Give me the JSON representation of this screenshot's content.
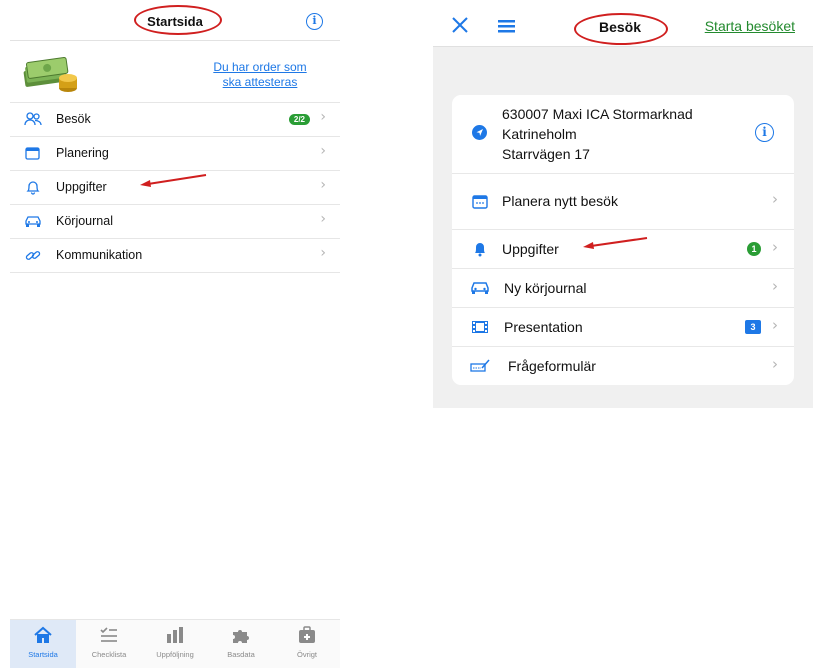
{
  "left": {
    "header": {
      "title": "Startsida",
      "info_icon": "info-circle-icon"
    },
    "order_notice": {
      "icon": "money-stack-icon",
      "line1": "Du har order som",
      "line2": "ska attesteras"
    },
    "menu": [
      {
        "label": "Besök",
        "icon": "people-icon",
        "badge": "2/2"
      },
      {
        "label": "Planering",
        "icon": "calendar-icon"
      },
      {
        "label": "Uppgifter",
        "icon": "bell-icon"
      },
      {
        "label": "Körjournal",
        "icon": "car-icon"
      },
      {
        "label": "Kommunikation",
        "icon": "link-icon"
      }
    ],
    "tabbar": [
      {
        "label": "Startsida",
        "icon": "home-icon",
        "active": true
      },
      {
        "label": "Checklista",
        "icon": "checklist-icon"
      },
      {
        "label": "Uppföljning",
        "icon": "bar-chart-icon"
      },
      {
        "label": "Basdata",
        "icon": "puzzle-icon"
      },
      {
        "label": "Övrigt",
        "icon": "medkit-icon"
      }
    ]
  },
  "right": {
    "header": {
      "title": "Besök",
      "action": "Starta besöket",
      "close_icon": "close-icon",
      "menu_icon": "hamburger-menu-icon"
    },
    "store": {
      "line1": "630007 Maxi ICA Stormarknad",
      "line2": "Katrineholm",
      "line3": "Starrvägen 17",
      "icon": "navigation-arrow-icon"
    },
    "menu": [
      {
        "label": "Planera nytt besök",
        "icon": "calendar-icon"
      },
      {
        "label": "Uppgifter",
        "icon": "bell-icon",
        "badge": "1"
      },
      {
        "label": "Ny körjournal",
        "icon": "car-icon"
      },
      {
        "label": "Presentation",
        "icon": "film-icon",
        "badge": "3"
      },
      {
        "label": "Frågeformulär",
        "icon": "form-icon"
      }
    ]
  },
  "colors": {
    "accent": "#1e78e6",
    "green": "#2a9d35",
    "annotation_red": "#d01f1f"
  }
}
